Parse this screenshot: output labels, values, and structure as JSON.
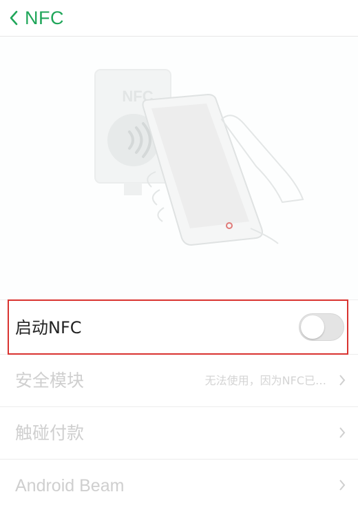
{
  "header": {
    "back_icon": "chevron-left-icon",
    "title": "NFC"
  },
  "illustration": {
    "card_text": "NFC",
    "card_icon": "nfc-wave-icon",
    "phone_icon": "phone-in-hand-icon"
  },
  "settings": {
    "nfc": {
      "label": "启动NFC",
      "enabled": false
    },
    "secure_element": {
      "label": "安全模块",
      "detail": "无法使用，因为NFC已…"
    },
    "tap_pay": {
      "label": "触碰付款"
    },
    "android_beam": {
      "label": "Android Beam"
    }
  },
  "colors": {
    "accent": "#1fa659",
    "highlight_border": "#d9322f",
    "disabled_text": "#cfcfcf"
  }
}
